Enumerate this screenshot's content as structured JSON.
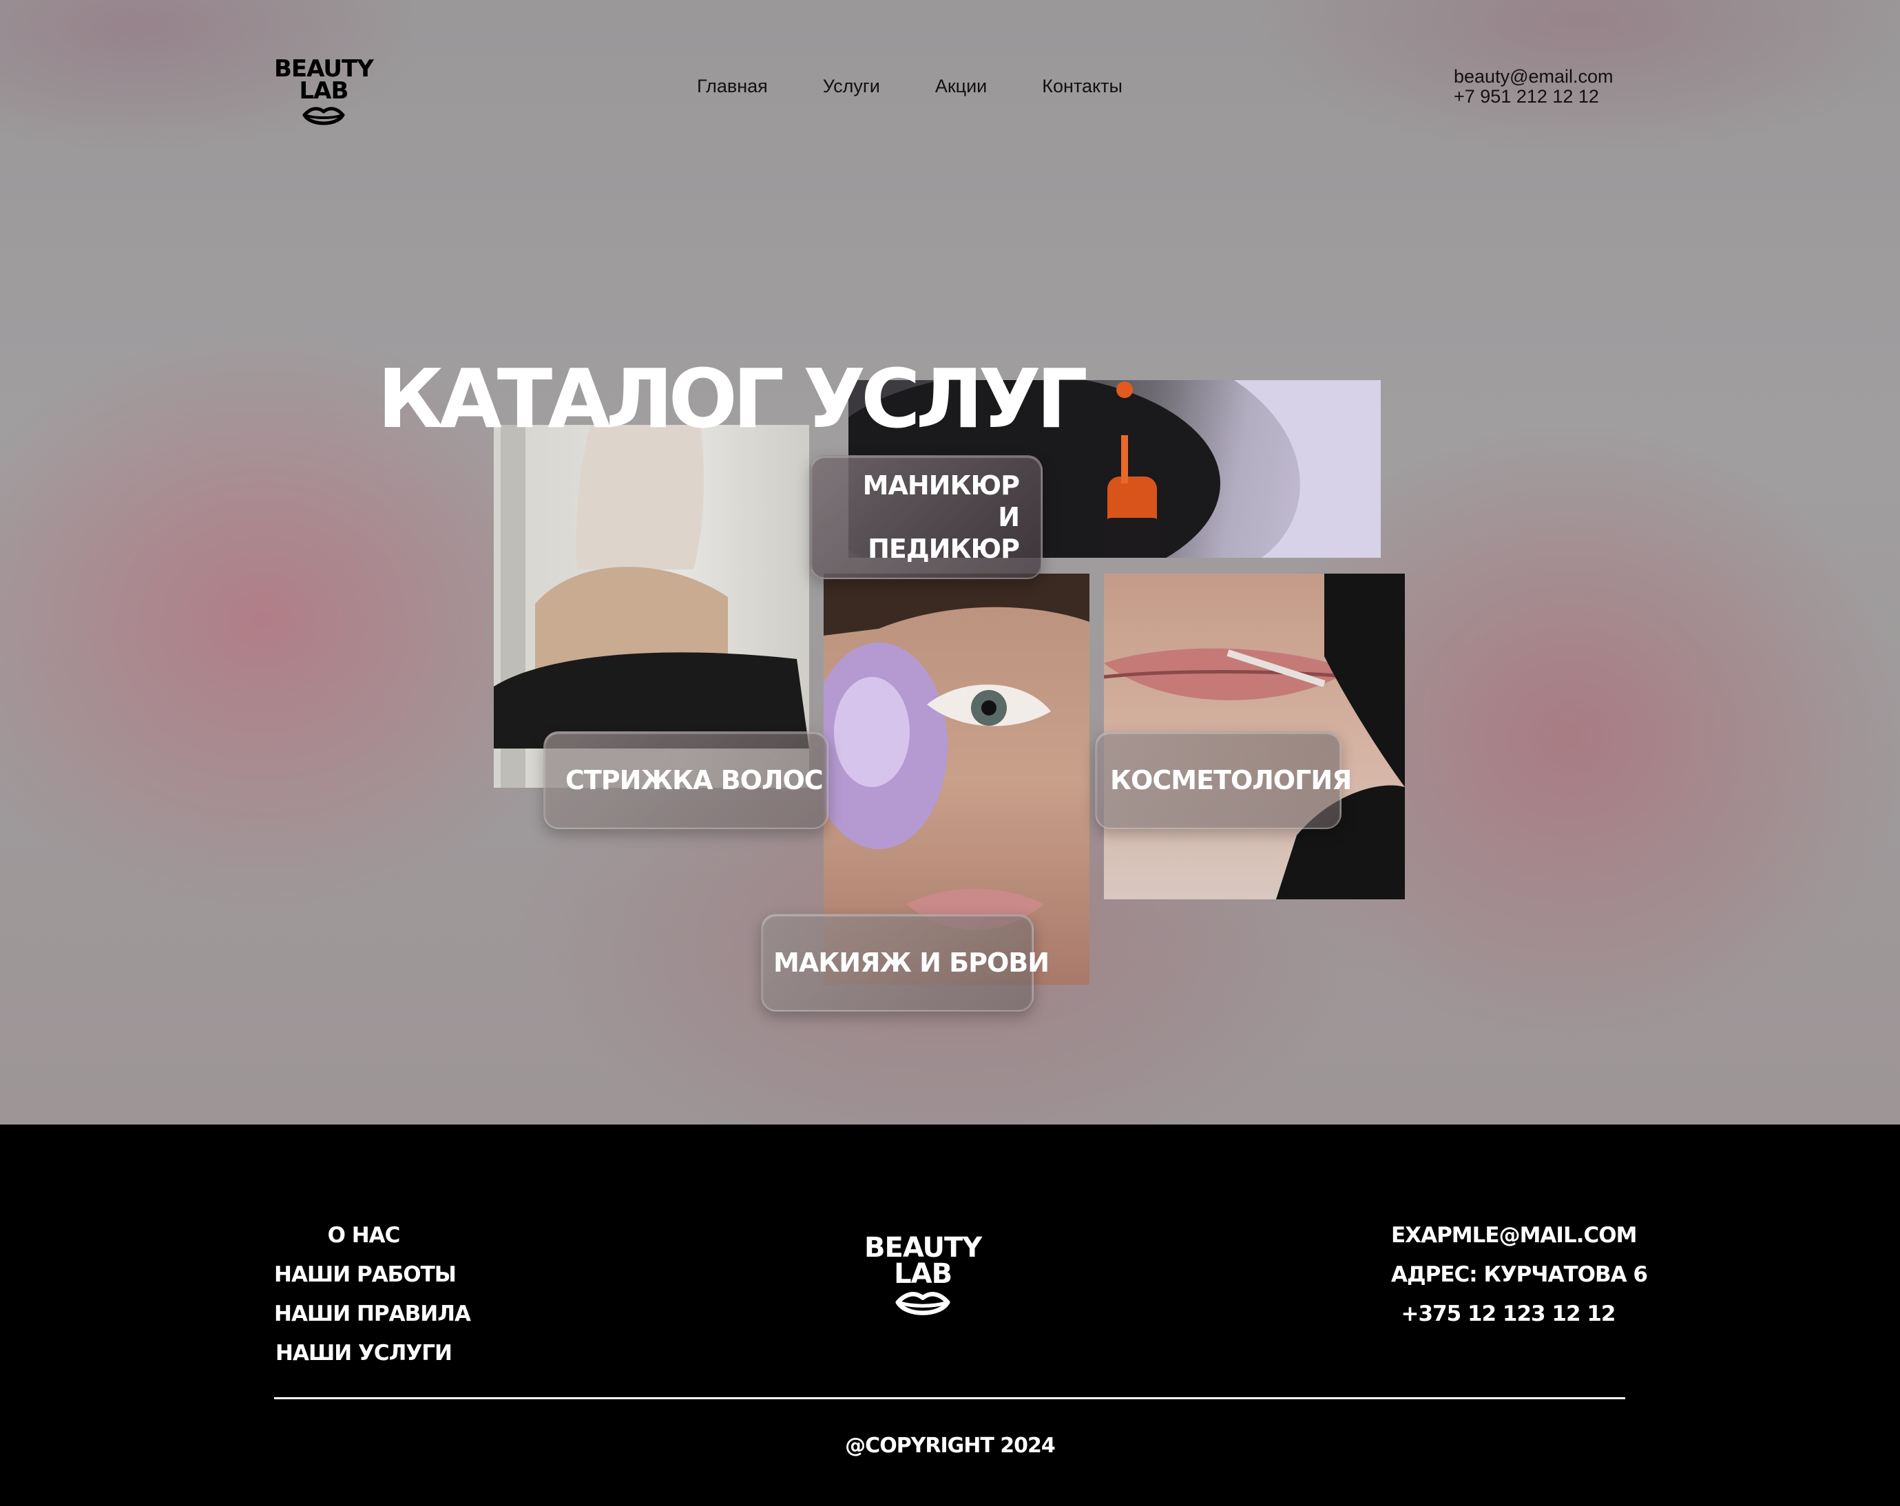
{
  "header": {
    "logo": {
      "line1": "BEAUTY",
      "line2": "LAB"
    },
    "nav": [
      "Главная",
      "Услуги",
      "Акции",
      "Контакты"
    ],
    "email": "beauty@email.com",
    "phone": "+7 951 212 12 12"
  },
  "catalog": {
    "title": "КАТАЛОГ УСЛУГ",
    "cards": {
      "haircut": "СТРИЖКА ВОЛОС",
      "manicure": [
        "МАНИКЮР",
        "И",
        "ПЕДИКЮР"
      ],
      "makeup": "МАКИЯЖ И БРОВИ",
      "cosmetology": "КОСМЕТОЛОГИЯ"
    }
  },
  "footer": {
    "links": [
      "О НАС",
      "НАШИ РАБОТЫ",
      "НАШИ ПРАВИЛА",
      "НАШИ УСЛУГИ"
    ],
    "logo": {
      "line1": "BEAUTY",
      "line2": "LAB"
    },
    "contacts": [
      "EXAPMLE@MAIL.COM",
      "АДРЕС: КУРЧАТОВА 6",
      "+375 12 123 12 12"
    ],
    "copyright": "@COPYRIGHT 2024"
  }
}
